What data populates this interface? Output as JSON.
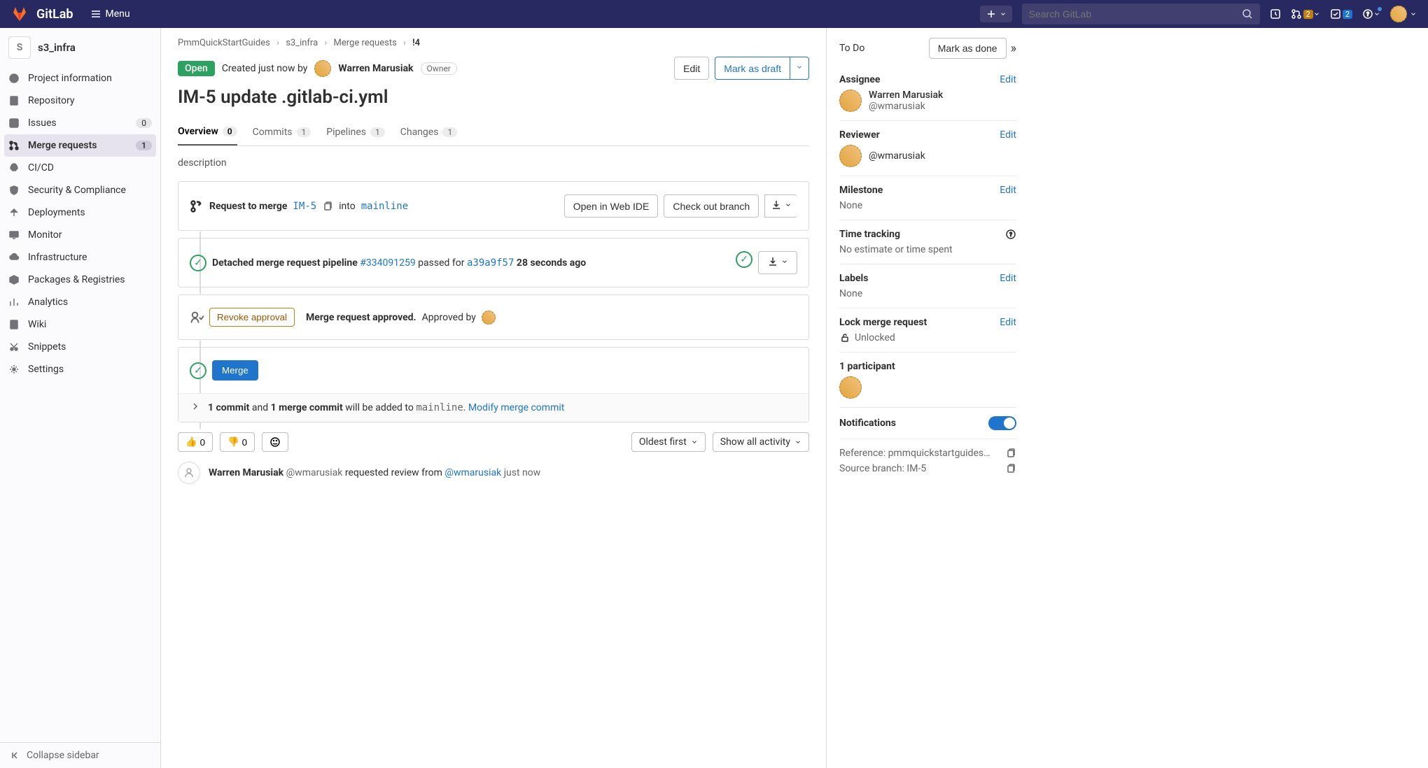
{
  "topnav": {
    "brand": "GitLab",
    "menu_label": "Menu",
    "search_placeholder": "Search GitLab",
    "mr_badge": "2",
    "todo_badge": "2"
  },
  "sidebar": {
    "project_initial": "S",
    "project_name": "s3_infra",
    "items": [
      {
        "label": "Project information"
      },
      {
        "label": "Repository"
      },
      {
        "label": "Issues",
        "count": "0"
      },
      {
        "label": "Merge requests",
        "count": "1"
      },
      {
        "label": "CI/CD"
      },
      {
        "label": "Security & Compliance"
      },
      {
        "label": "Deployments"
      },
      {
        "label": "Monitor"
      },
      {
        "label": "Infrastructure"
      },
      {
        "label": "Packages & Registries"
      },
      {
        "label": "Analytics"
      },
      {
        "label": "Wiki"
      },
      {
        "label": "Snippets"
      },
      {
        "label": "Settings"
      }
    ],
    "collapse_label": "Collapse sidebar"
  },
  "breadcrumb": {
    "group": "PmmQuickStartGuides",
    "project": "s3_infra",
    "section": "Merge requests",
    "id": "!4"
  },
  "mr": {
    "status": "Open",
    "created_prefix": "Created just now by",
    "author": "Warren Marusiak",
    "author_role": "Owner",
    "title": "IM-5 update .gitlab-ci.yml",
    "actions": {
      "edit": "Edit",
      "draft": "Mark as draft"
    }
  },
  "tabs": {
    "overview": {
      "label": "Overview",
      "count": "0"
    },
    "commits": {
      "label": "Commits",
      "count": "1"
    },
    "pipelines": {
      "label": "Pipelines",
      "count": "1"
    },
    "changes": {
      "label": "Changes",
      "count": "1"
    }
  },
  "description": "description",
  "merge_box": {
    "request_label": "Request to merge",
    "source_branch": "IM-5",
    "into_label": "into",
    "target_branch": "mainline",
    "open_ide": "Open in Web IDE",
    "checkout": "Check out branch"
  },
  "pipeline_box": {
    "prefix": "Detached merge request pipeline",
    "pipeline_link": "#334091259",
    "mid": "passed for",
    "commit_link": "a39a9f57",
    "time": "28 seconds ago"
  },
  "approval_box": {
    "revoke_label": "Revoke approval",
    "approved_text": "Merge request approved.",
    "approved_by": "Approved by"
  },
  "merge_section": {
    "merge_label": "Merge",
    "commit1": "1 commit",
    "and": "and",
    "commit2": "1 merge commit",
    "added": "will be added to",
    "target": "mainline",
    "modify": "Modify merge commit"
  },
  "reactions": {
    "thumbs_up": "0",
    "thumbs_down": "0",
    "sort_label": "Oldest first",
    "filter_label": "Show all activity"
  },
  "activity": {
    "author": "Warren Marusiak",
    "handle": "@wmarusiak",
    "action": "requested review from",
    "target": "@wmarusiak",
    "time": "just now"
  },
  "rightpanel": {
    "todo_label": "To Do",
    "mark_done": "Mark as done",
    "assignee_label": "Assignee",
    "assignee_name": "Warren Marusiak",
    "assignee_handle": "@wmarusiak",
    "reviewer_label": "Reviewer",
    "reviewer_handle": "@wmarusiak",
    "milestone_label": "Milestone",
    "milestone_value": "None",
    "time_label": "Time tracking",
    "time_value": "No estimate or time spent",
    "labels_label": "Labels",
    "labels_value": "None",
    "lock_label": "Lock merge request",
    "lock_value": "Unlocked",
    "participants_label": "1 participant",
    "notifications_label": "Notifications",
    "reference_label": "Reference: pmmquickstartguides…",
    "source_label": "Source branch: IM-5",
    "edit": "Edit"
  }
}
